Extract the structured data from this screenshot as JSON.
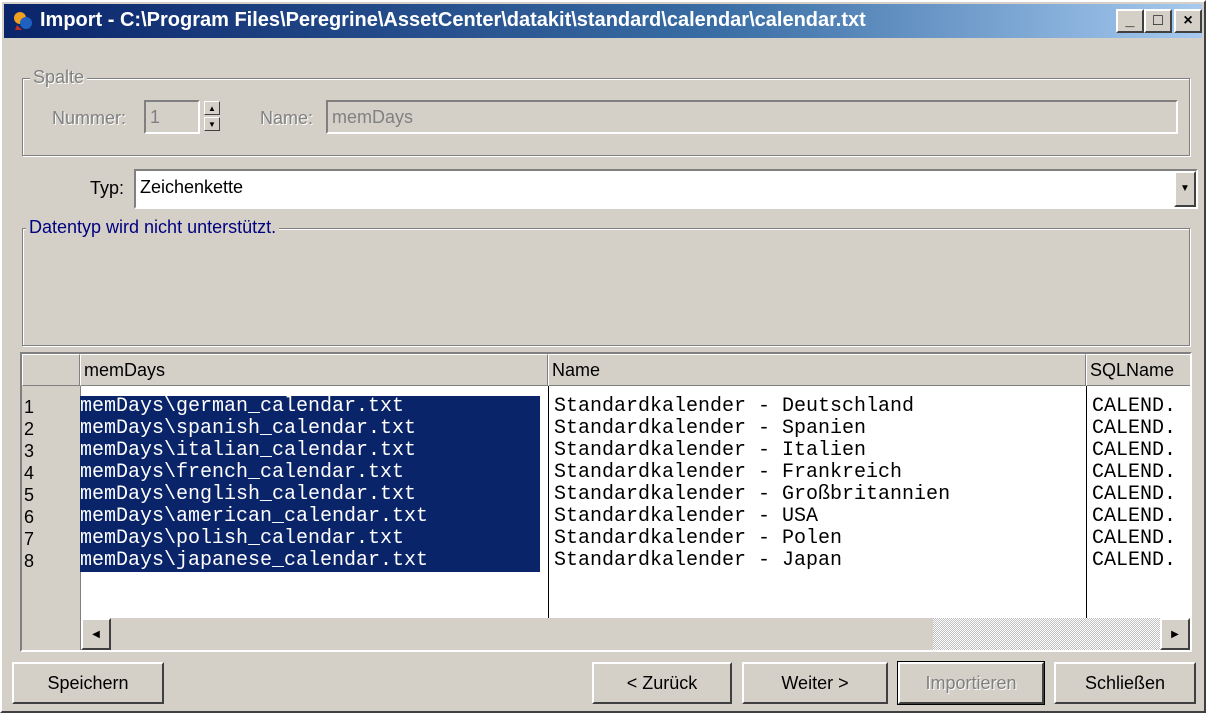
{
  "window": {
    "title": "Import - C:\\Program Files\\Peregrine\\AssetCenter\\datakit\\standard\\calendar\\calendar.txt",
    "minimize_glyph": "_",
    "maximize_glyph": "□",
    "close_glyph": "×"
  },
  "spalte": {
    "legend": "Spalte",
    "nummer_label": "Nummer:",
    "nummer_value": "1",
    "name_label": "Name:",
    "name_value": "memDays"
  },
  "typ": {
    "label": "Typ:",
    "value": "Zeichenkette"
  },
  "datatype": {
    "legend": "Datentyp wird nicht unterstützt."
  },
  "grid": {
    "columns": [
      "memDays",
      "Name",
      "SQLName"
    ],
    "rows": [
      {
        "num": "1",
        "memDays": "memDays\\german_calendar.txt",
        "name": "Standardkalender - Deutschland",
        "sql": "CALEND."
      },
      {
        "num": "2",
        "memDays": "memDays\\spanish_calendar.txt",
        "name": "Standardkalender - Spanien",
        "sql": "CALEND."
      },
      {
        "num": "3",
        "memDays": "memDays\\italian_calendar.txt",
        "name": "Standardkalender - Italien",
        "sql": "CALEND."
      },
      {
        "num": "4",
        "memDays": "memDays\\french_calendar.txt",
        "name": "Standardkalender - Frankreich",
        "sql": "CALEND."
      },
      {
        "num": "5",
        "memDays": "memDays\\english_calendar.txt",
        "name": "Standardkalender - Großbritannien",
        "sql": "CALEND."
      },
      {
        "num": "6",
        "memDays": "memDays\\american_calendar.txt",
        "name": "Standardkalender - USA",
        "sql": "CALEND."
      },
      {
        "num": "7",
        "memDays": "memDays\\polish_calendar.txt",
        "name": "Standardkalender - Polen",
        "sql": "CALEND."
      },
      {
        "num": "8",
        "memDays": "memDays\\japanese_calendar.txt",
        "name": "Standardkalender - Japan",
        "sql": "CALEND."
      }
    ]
  },
  "buttons": {
    "speichern": "Speichern",
    "zurueck": "< Zurück",
    "weiter": "Weiter >",
    "importieren": "Importieren",
    "schliessen": "Schließen"
  },
  "colors": {
    "selection": "#0a246a",
    "dialog_face": "#d4d0c8",
    "legend_blue": "#000080"
  }
}
